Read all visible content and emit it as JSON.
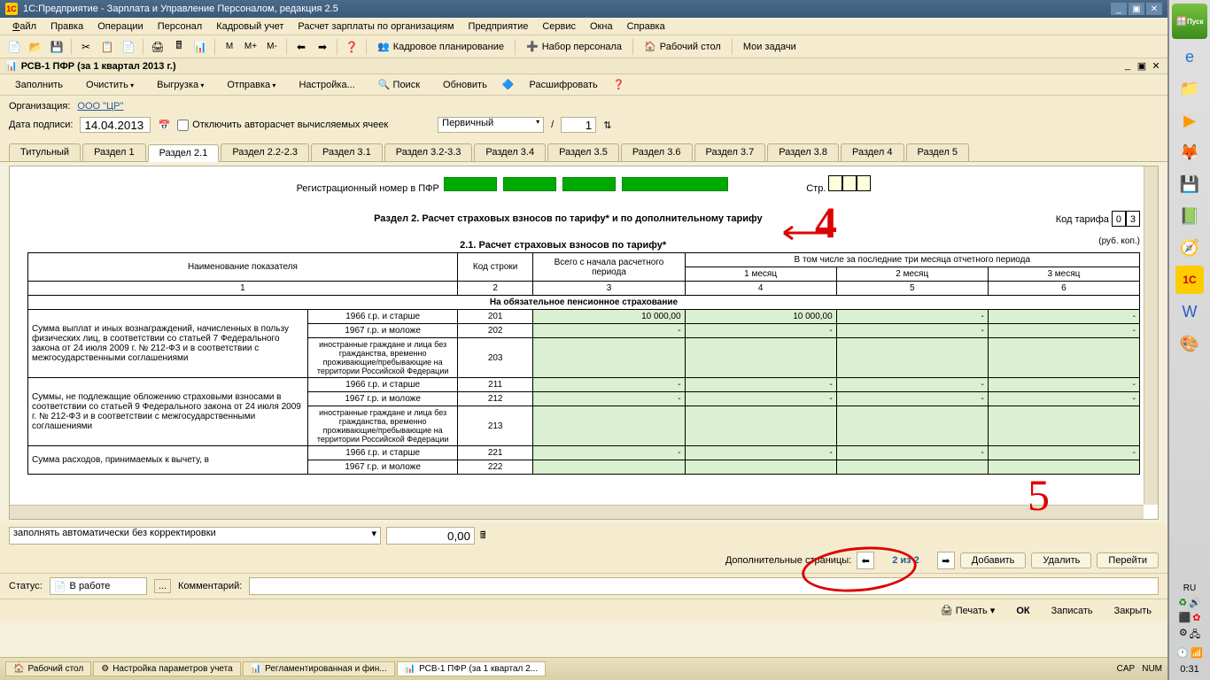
{
  "window": {
    "title": "1С:Предприятие - Зарплата и Управление Персоналом, редакция 2.5"
  },
  "menu": {
    "file": "Файл",
    "edit": "Правка",
    "ops": "Операции",
    "personnel": "Персонал",
    "hr": "Кадровый учет",
    "salary": "Расчет зарплаты по организациям",
    "enterprise": "Предприятие",
    "service": "Сервис",
    "windows": "Окна",
    "help": "Справка"
  },
  "toolbar2": {
    "hrplan": "Кадровое планирование",
    "recruit": "Набор персонала",
    "desktop": "Рабочий стол",
    "tasks": "Мои задачи"
  },
  "doc": {
    "title": "РСВ-1 ПФР (за 1 квартал 2013 г.)"
  },
  "cmd": {
    "fill": "Заполнить",
    "clear": "Очистить",
    "export": "Выгрузка",
    "send": "Отправка",
    "settings": "Настройка...",
    "search": "Поиск",
    "refresh": "Обновить",
    "decode": "Расшифровать"
  },
  "header": {
    "orgLabel": "Организация:",
    "org": "ООО \"ЦР\"",
    "signLabel": "Дата подписи:",
    "signDate": "14.04.2013",
    "disableAuto": "Отключить авторасчет вычисляемых ячеек",
    "docType": "Первичный",
    "num": "1"
  },
  "tabs": [
    "Титульный",
    "Раздел 1",
    "Раздел 2.1",
    "Раздел 2.2-2.3",
    "Раздел 3.1",
    "Раздел 3.2-3.3",
    "Раздел 3.4",
    "Раздел 3.5",
    "Раздел 3.6",
    "Раздел 3.7",
    "Раздел 3.8",
    "Раздел 4",
    "Раздел 5"
  ],
  "report": {
    "regLabel": "Регистрационный номер в ПФР",
    "strLabel": "Стр.",
    "sectionTitle": "Раздел 2. Расчет страховых взносов по тарифу* и по дополнительному тарифу",
    "tarifLabel": "Код тарифа",
    "tarifCode": [
      "0",
      "3"
    ],
    "subTitle": "2.1. Расчет страховых взносов по тарифу*",
    "rubnote": "(руб. коп.)",
    "cols": {
      "c1": "Наименование показателя",
      "c2": "Код строки",
      "c3": "Всего с начала расчетного периода",
      "c4": "В том числе за последние три месяца отчетного периода",
      "m1": "1 месяц",
      "m2": "2 месяц",
      "m3": "3 месяц"
    },
    "numrow": [
      "1",
      "2",
      "3",
      "4",
      "5",
      "6"
    ],
    "grphdr": "На обязательное пенсионное страхование",
    "row1name": "Сумма выплат и иных вознаграждений, начисленных в пользу физических лиц, в соответствии со статьей 7 Федерального закона от 24 июля 2009 г. № 212-ФЗ и в соответствии с межгосударственными соглашениями",
    "row1a": {
      "age": "1966 г.р. и старше",
      "code": "201",
      "total": "10 000,00",
      "m1": "10 000,00",
      "m2": "-",
      "m3": "-"
    },
    "row1b": {
      "age": "1967 г.р. и моложе",
      "code": "202",
      "total": "-",
      "m1": "-",
      "m2": "-",
      "m3": "-"
    },
    "row1c": {
      "age": "иностранные граждане и лица без гражданства, временно проживающие/пребывающие на территории Российской Федерации",
      "code": "203",
      "total": "",
      "m1": "",
      "m2": "",
      "m3": ""
    },
    "row2name": "Суммы, не подлежащие обложению страховыми взносами в соответствии со статьей 9 Федерального закона от 24 июля 2009 г. № 212-ФЗ и в соответствии с межгосударственными соглашениями",
    "row2a": {
      "age": "1966 г.р. и старше",
      "code": "211",
      "total": "-",
      "m1": "-",
      "m2": "-",
      "m3": "-"
    },
    "row2b": {
      "age": "1967 г.р. и моложе",
      "code": "212",
      "total": "-",
      "m1": "-",
      "m2": "-",
      "m3": "-"
    },
    "row2c": {
      "age": "иностранные граждане и лица без гражданства, временно проживающие/пребывающие на территории Российской Федерации",
      "code": "213",
      "total": "",
      "m1": "",
      "m2": "",
      "m3": ""
    },
    "row3name": "Сумма расходов, принимаемых к вычету, в",
    "row3a": {
      "age": "1966 г.р. и старше",
      "code": "221",
      "total": "-",
      "m1": "-",
      "m2": "-",
      "m3": "-"
    },
    "row3b": {
      "age": "1967 г.р. и моложе",
      "code": "222",
      "total": "",
      "m1": "",
      "m2": "",
      "m3": ""
    }
  },
  "bottom": {
    "mode": "заполнять автоматически без корректировки",
    "amount": "0,00"
  },
  "pager": {
    "label": "Дополнительные страницы:",
    "indicator": "2 из 2",
    "add": "Добавить",
    "del": "Удалить",
    "goto": "Перейти"
  },
  "status": {
    "label": "Статус:",
    "value": "В работе",
    "commentLabel": "Комментарий:"
  },
  "footer": {
    "print": "Печать",
    "ok": "ОК",
    "save": "Записать",
    "close": "Закрыть"
  },
  "taskbar": {
    "t1": "Рабочий стол",
    "t2": "Настройка параметров учета",
    "t3": "Регламентированная и фин...",
    "t4": "РСВ-1 ПФР (за 1 квартал 2..."
  },
  "tray": {
    "cap": "CAP",
    "num": "NUM",
    "time": "0:31"
  },
  "rpanel": {
    "start": "Пуск",
    "lang": "RU"
  }
}
